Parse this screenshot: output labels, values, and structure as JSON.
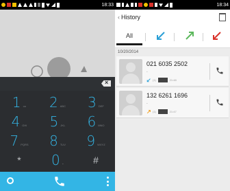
{
  "left_screen": {
    "status_time": "18:33",
    "keys": [
      {
        "digit": "1",
        "letters": "oo"
      },
      {
        "digit": "2",
        "letters": "ABC"
      },
      {
        "digit": "3",
        "letters": "DEF"
      },
      {
        "digit": "4",
        "letters": "GHI"
      },
      {
        "digit": "5",
        "letters": "JKL"
      },
      {
        "digit": "6",
        "letters": "MNO"
      },
      {
        "digit": "7",
        "letters": "PQRS"
      },
      {
        "digit": "8",
        "letters": "TUV"
      },
      {
        "digit": "9",
        "letters": "WXYZ"
      },
      {
        "digit": "*",
        "letters": ""
      },
      {
        "digit": "0",
        "letters": "+"
      },
      {
        "digit": "#",
        "letters": ""
      }
    ],
    "accent": "#33b5e5"
  },
  "right_screen": {
    "status_time": "18:34",
    "header": {
      "back": "‹",
      "title": "History"
    },
    "filters": {
      "all": "All"
    },
    "date": "10/20/2014",
    "calls": [
      {
        "number": "021 6035 2502",
        "sub": "-",
        "sim": "(1)",
        "time": "21:48",
        "direction": "incoming"
      },
      {
        "number": "132 6261 1696",
        "sub": "-",
        "sim": "(1)",
        "time": "21:47",
        "direction": "outgoing"
      }
    ],
    "colors": {
      "incoming": "#2a9fd6",
      "outgoing": "#5cb85c",
      "missed": "#d9322b"
    }
  }
}
